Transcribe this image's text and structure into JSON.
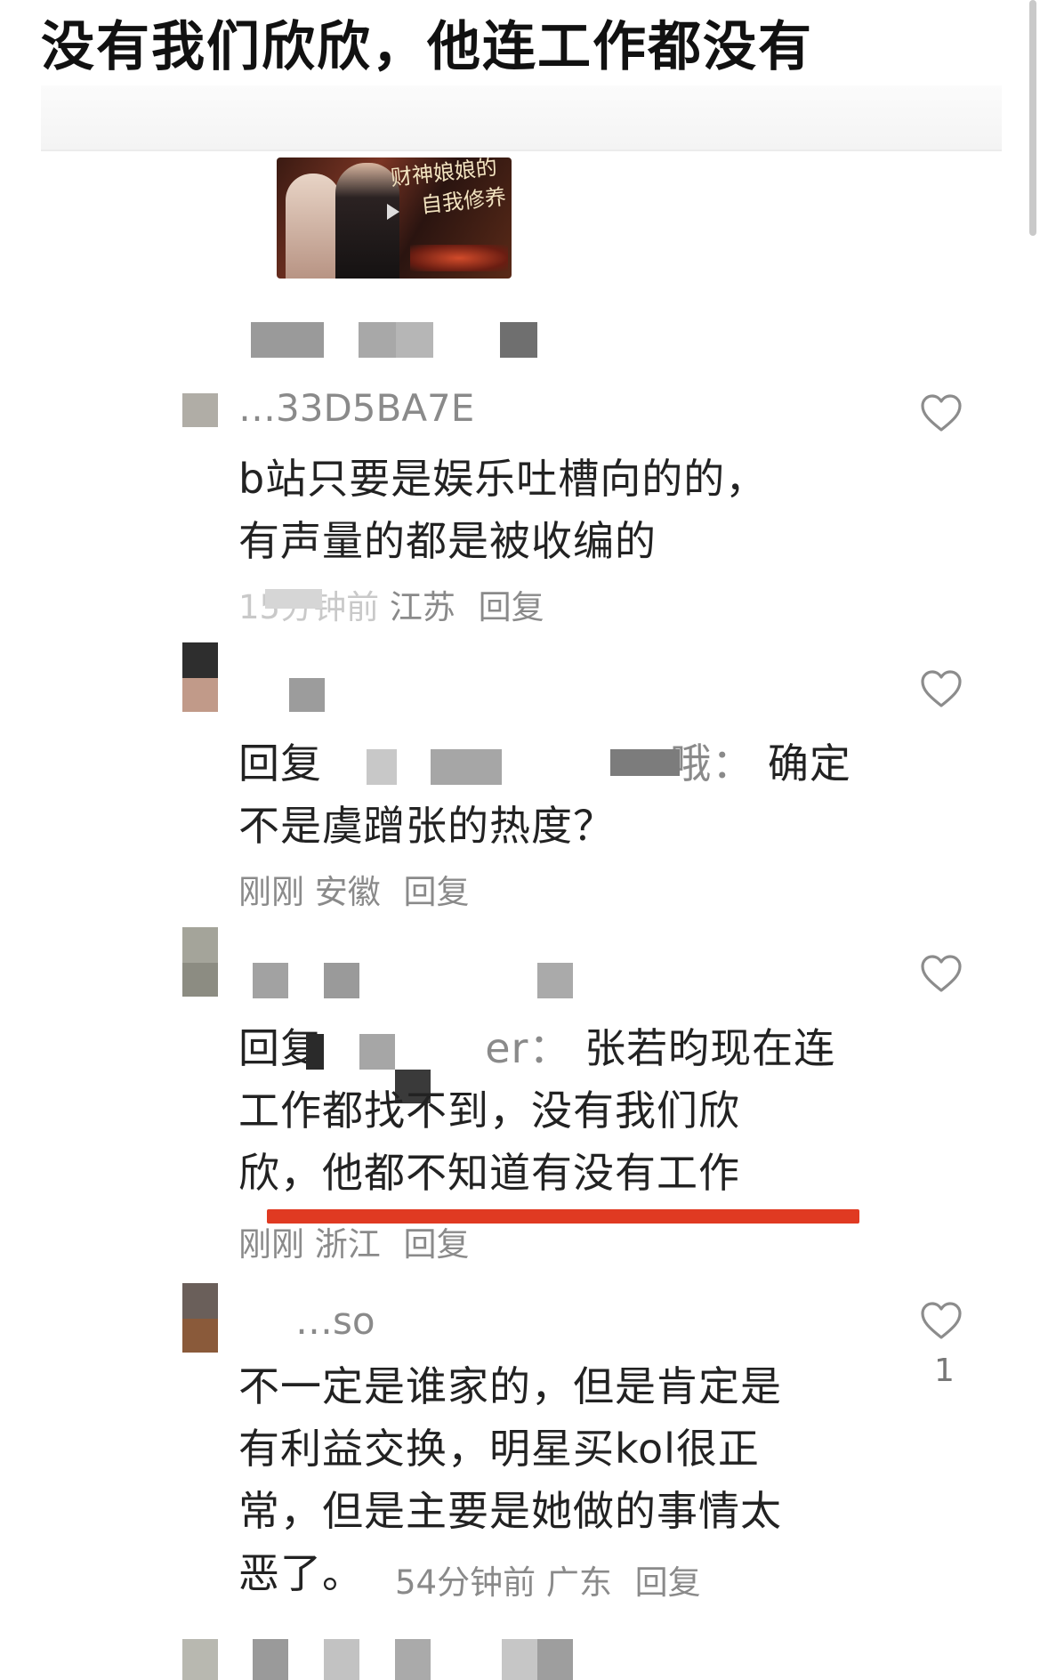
{
  "headline": "没有我们欣欣，他连工作都没有",
  "video": {
    "title_line1": "财神娘娘的",
    "title_line2": "自我修养"
  },
  "comments": [
    {
      "username": "…33D5BA7E",
      "line1": "b站只要是娱乐吐槽向的的，",
      "line2": "有声量的都是被收编的",
      "time": "15分钟前",
      "location": "江苏",
      "reply": "回复"
    },
    {
      "prefix": "回复",
      "reply_target_suffix": "哦：",
      "line1_tail": "确定",
      "line2": "不是虞蹭张的热度？",
      "time": "刚刚",
      "location": "安徽",
      "reply": "回复"
    },
    {
      "prefix": "回复",
      "reply_target_suffix": "er：",
      "line1_tail": "张若昀现在连",
      "line2": "工作都找不到，没有我们欣",
      "line3": "欣，他都不知道有没有工作",
      "time": "刚刚",
      "location": "浙江",
      "reply": "回复"
    },
    {
      "username": "…so",
      "line1": "不一定是谁家的，但是肯定是",
      "line2": "有利益交换，明星买kol很正",
      "line3": "常，但是主要是她做的事情太",
      "line4": "恶了。",
      "time": "54分钟前",
      "location": "广东",
      "reply": "回复",
      "likes": "1"
    }
  ],
  "icons": {
    "like": "heart-outline-icon",
    "play": "play-icon"
  },
  "colors": {
    "highlight_underline": "#e03a22",
    "meta_gray": "#8a8a8a",
    "text": "#222222"
  }
}
